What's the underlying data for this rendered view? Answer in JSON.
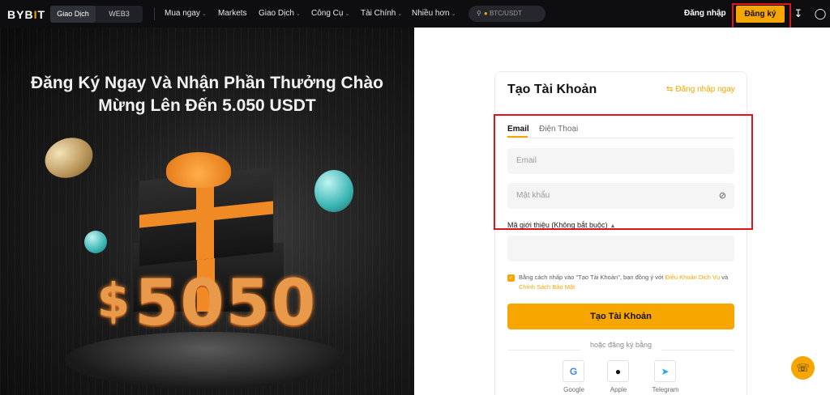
{
  "brand": {
    "logo": "BYB",
    "logo_mark": "I",
    "logo_end": "T"
  },
  "nav": {
    "seg_trade": "Giao Dịch",
    "seg_web3": "WEB3",
    "items": [
      {
        "label": "Mua ngay",
        "has_chevron": true
      },
      {
        "label": "Markets",
        "has_chevron": false
      },
      {
        "label": "Giao Dịch",
        "has_chevron": true
      },
      {
        "label": "Công Cụ",
        "has_chevron": true
      },
      {
        "label": "Tài Chính",
        "has_chevron": true
      },
      {
        "label": "Nhiều hơn",
        "has_chevron": true
      }
    ],
    "search_placeholder": "BTC/USDT",
    "login": "Đăng nhập",
    "signup": "Đăng ký",
    "icons": [
      "download-icon",
      "globe-icon"
    ]
  },
  "promo": {
    "title_line1": "Đăng Ký Ngay Và Nhận Phần Thưởng Chào",
    "title_line2": "Mừng Lên Đến 5.050 USDT",
    "amount_symbol": "$",
    "amount": "5050"
  },
  "form": {
    "title": "Tạo Tài Khoản",
    "login_now": "Đăng nhập ngay",
    "tabs": [
      {
        "label": "Email",
        "active": true
      },
      {
        "label": "Điện Thoại",
        "active": false
      }
    ],
    "email_placeholder": "Email",
    "password_placeholder": "Mật khẩu",
    "referral_label": "Mã giới thiệu (Không bắt buộc)",
    "referral_value": "",
    "agree_prefix": "Bằng cách nhấp vào \"Tạo Tài Khoản\", bạn đồng ý với ",
    "terms_link": "Điều Khoản Dịch Vụ",
    "agree_mid": " và ",
    "privacy_link": "Chính Sách Bảo Mật",
    "agree_checked": true,
    "submit": "Tạo Tài Khoản",
    "or_signup": "hoặc đăng ký bằng",
    "social": [
      {
        "label": "Google",
        "icon": "google-icon"
      },
      {
        "label": "Apple",
        "icon": "apple-icon"
      },
      {
        "label": "Telegram",
        "icon": "telegram-icon"
      }
    ]
  },
  "colors": {
    "accent": "#f7a600",
    "annotation": "#e2131a",
    "nav_bg": "#0e0e10"
  }
}
